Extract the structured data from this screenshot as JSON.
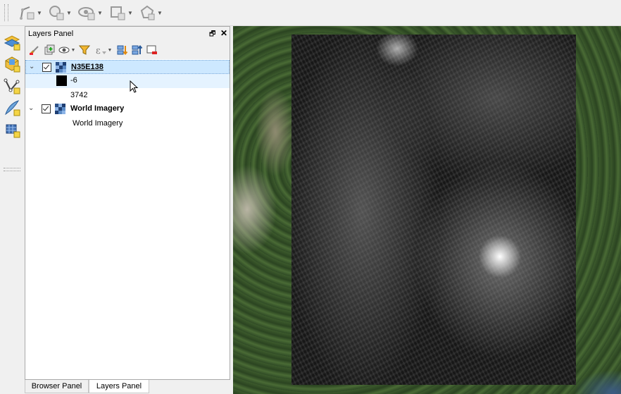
{
  "toolbar": {
    "items": [
      {
        "icon": "digitize-line-icon"
      },
      {
        "icon": "select-features-icon"
      },
      {
        "icon": "show-hide-icon"
      },
      {
        "icon": "add-feature-icon"
      },
      {
        "icon": "node-tool-icon"
      }
    ]
  },
  "left_toolbar": {
    "items": [
      "add-layer-icon",
      "add-database-layer-icon",
      "new-vector-layer-icon",
      "digitize-icon",
      "raster-tool-icon"
    ]
  },
  "layers_panel": {
    "title": "Layers Panel",
    "toolbar_icons": [
      "style-icon",
      "add-group-icon",
      "visibility-icon",
      "filter-icon",
      "expression-filter-icon",
      "expand-all-icon",
      "collapse-all-icon",
      "remove-layer-icon"
    ],
    "layers": [
      {
        "name": "N35E138",
        "checked": true,
        "legend": {
          "min_label": "-6",
          "max_label": "3742"
        }
      },
      {
        "name": "World Imagery",
        "checked": true,
        "legend_label": "World Imagery"
      }
    ]
  },
  "tabs": [
    "Browser Panel",
    "Layers Panel"
  ],
  "colors": {
    "selection": "#cde8ff",
    "panel_bg": "#f0f0f0"
  }
}
